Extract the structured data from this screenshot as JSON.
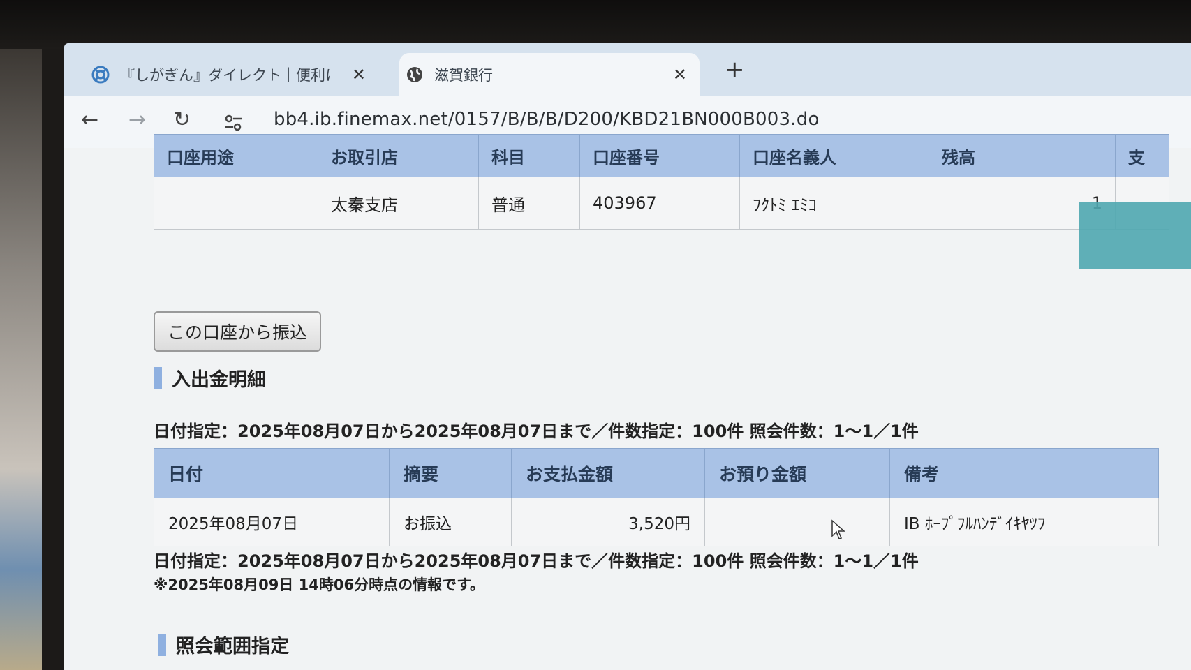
{
  "browser": {
    "tabs": [
      {
        "title": "『しがぎん』ダイレクト｜便利につか",
        "close": "✕",
        "icon": "lifebuoy-icon"
      },
      {
        "title": "滋賀銀行",
        "close": "✕",
        "icon": "globe-icon"
      }
    ],
    "new_tab": "+",
    "url": "bb4.ib.finemax.net/0157/B/B/B/D200/KBD21BN000B003.do"
  },
  "account_table": {
    "headers": [
      "口座用途",
      "お取引店",
      "科目",
      "口座番号",
      "口座名義人",
      "残高",
      "支"
    ],
    "row": [
      "",
      "太秦支店",
      "普通",
      "403967",
      "ﾌｸﾄﾐ ｴﾐｺ",
      "1",
      ""
    ]
  },
  "transfer_button": "この口座から振込",
  "details_section_title": "入出金明細",
  "range_text": "日付指定：2025年08月07日から2025年08月07日まで／件数指定：100件 照会件数：1〜1／1件",
  "transactions": {
    "headers": [
      "日付",
      "摘要",
      "お支払金額",
      "お預り金額",
      "備考"
    ],
    "rows": [
      [
        "2025年08月07日",
        "お振込",
        "3,520円",
        "",
        "IB ﾎｰﾌﾟﾌﾙﾊﾝﾃﾞｲｷﾔﾂﾌ"
      ]
    ]
  },
  "note": "※2025年08月09日 14時06分時点の情報です。",
  "range_section_title": "照会範囲指定",
  "colors": {
    "header_bg": "#a9c2e6",
    "accent_bar": "#8fb0e0",
    "redaction": "#4fa7b0"
  }
}
